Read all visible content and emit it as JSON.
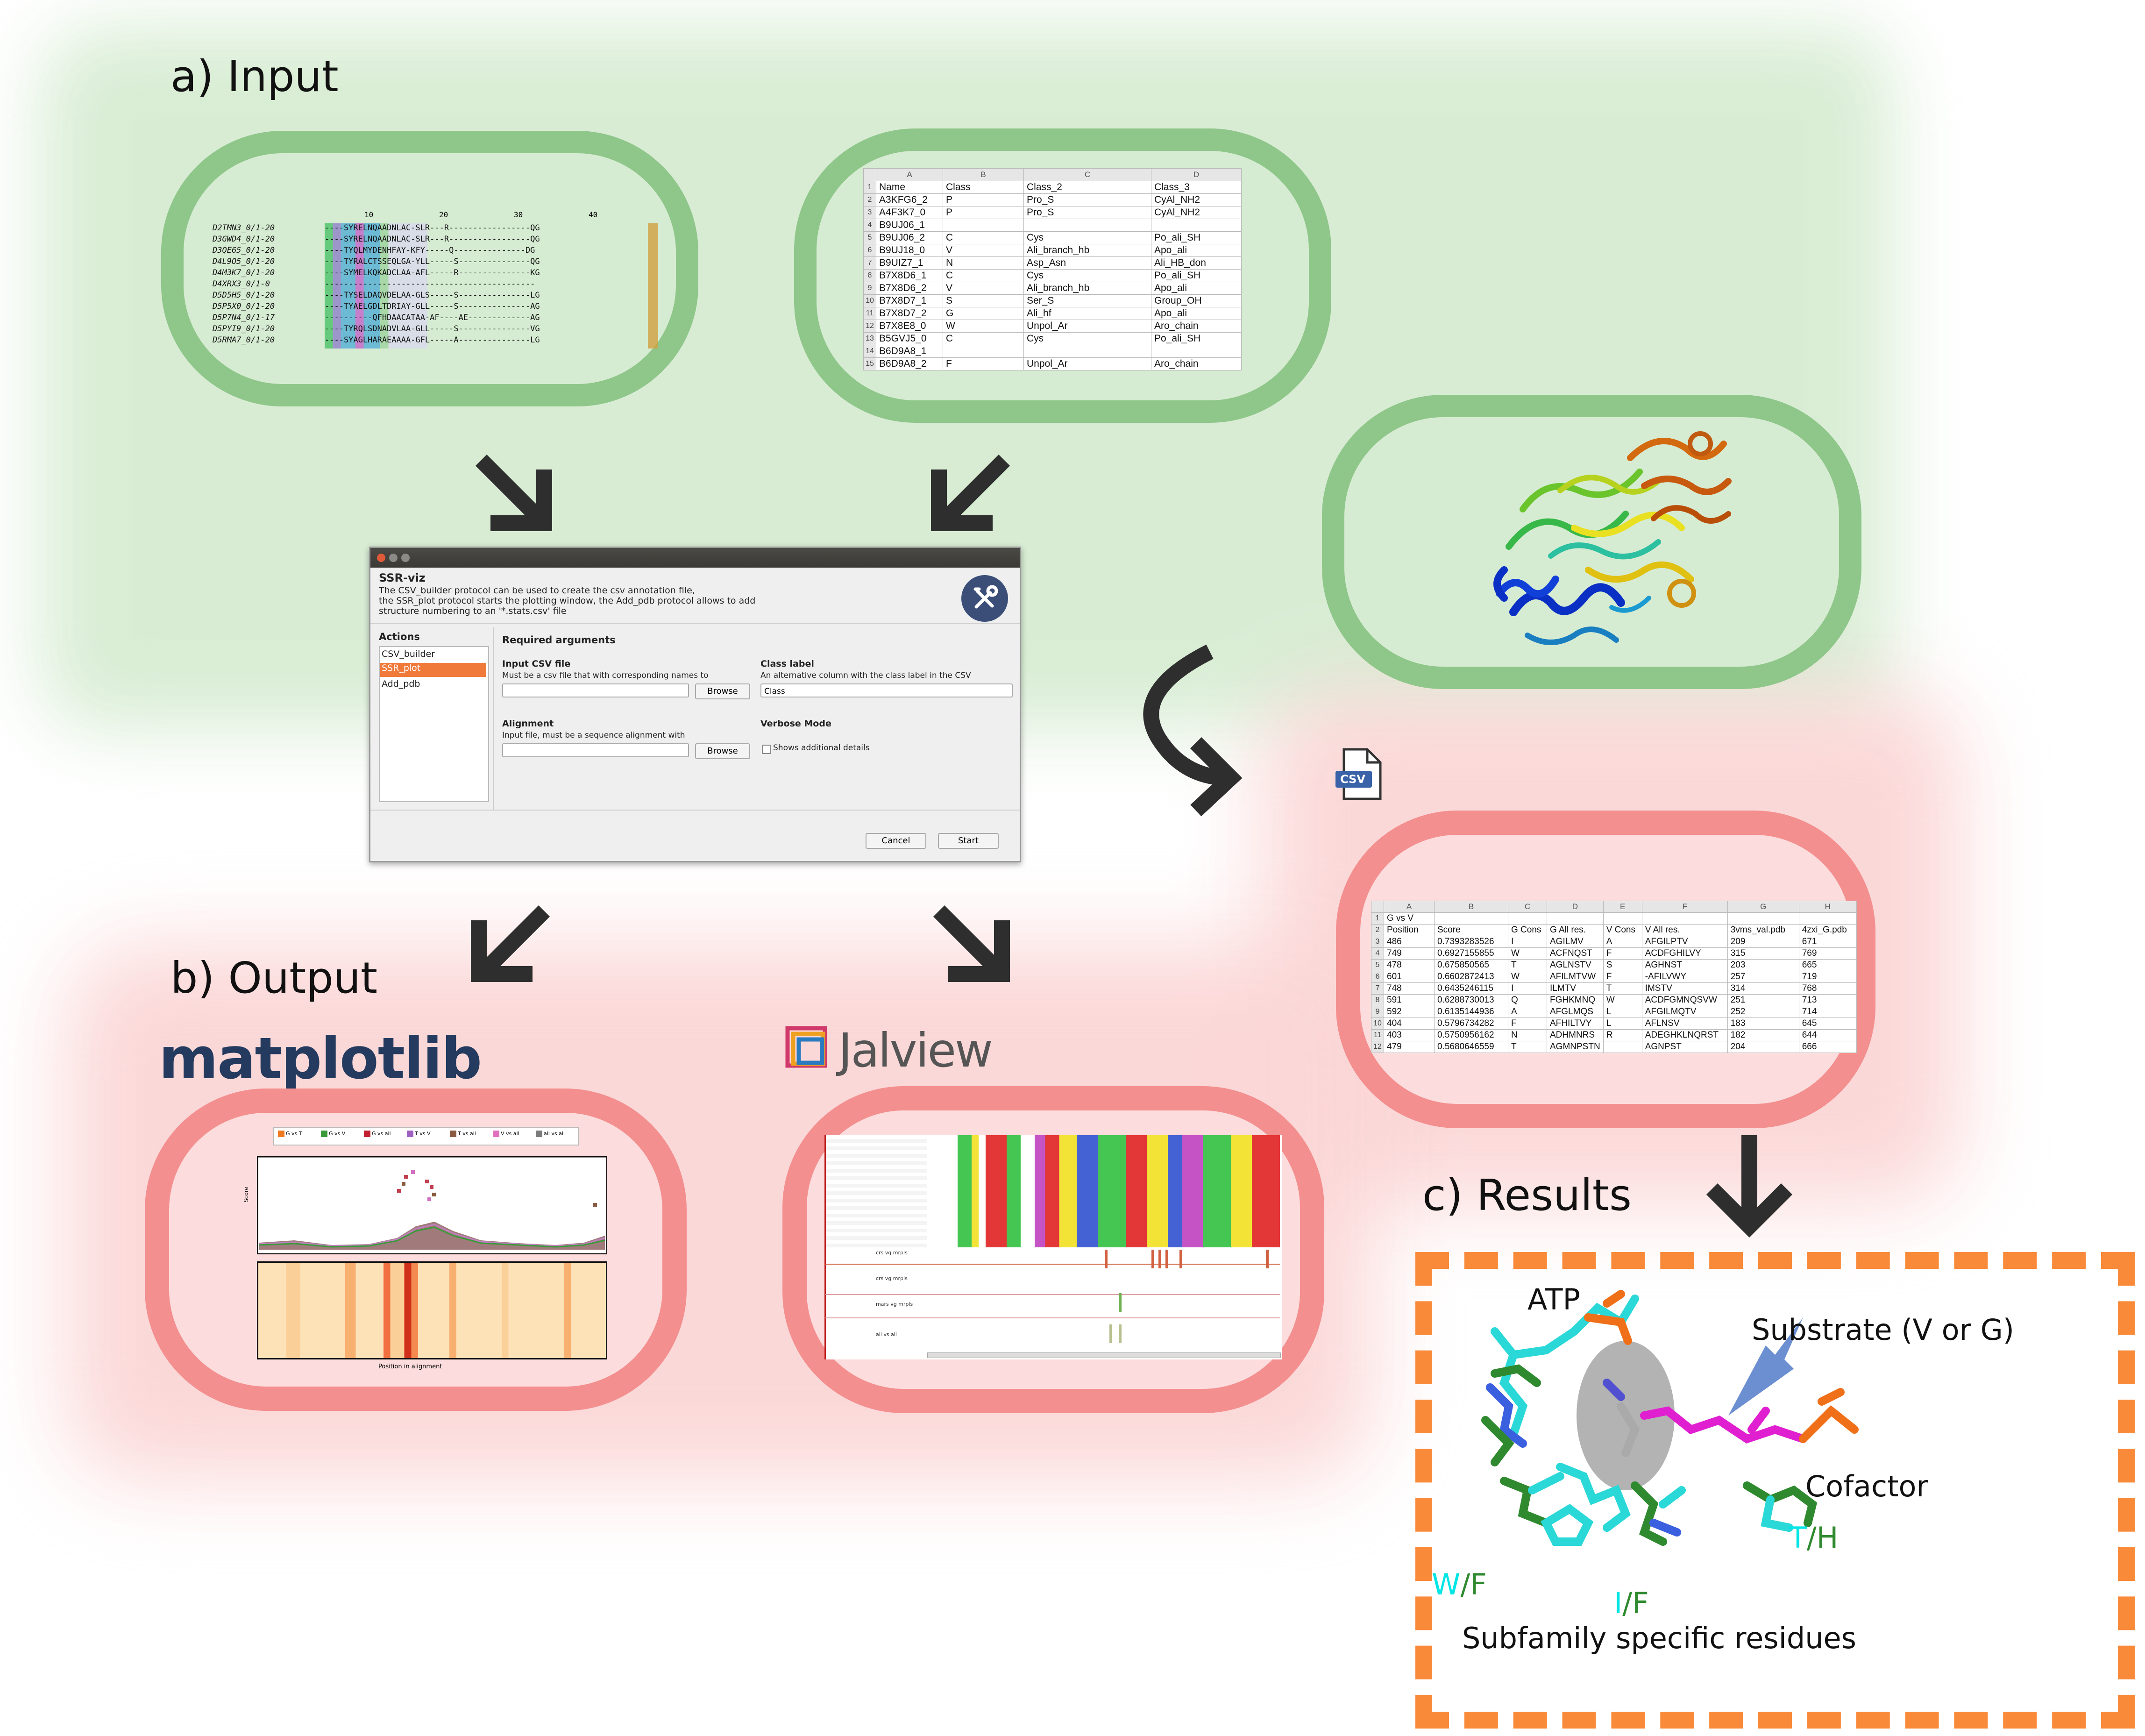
{
  "sections": {
    "input": "a) Input",
    "output": "b) Output",
    "results": "c) Results"
  },
  "alignment": {
    "ruler": [
      "10",
      "20",
      "30",
      "40"
    ],
    "rows": [
      {
        "name": "D2TMN3_0/1-20",
        "seq": "----SYRELNQAADNLAC-SLR---R-----------------QG"
      },
      {
        "name": "D3GWD4_0/1-20",
        "seq": "----SYRELNQAADNLAC-SLR---R-----------------QG"
      },
      {
        "name": "D3QE65_0/1-20",
        "seq": "----TYQLMYDENHFAY-KFY-----Q---------------DG"
      },
      {
        "name": "D4L9O5_0/1-20",
        "seq": "----TYRALCTSSEQLGA-YLL-----S---------------QG"
      },
      {
        "name": "D4M3K7_0/1-20",
        "seq": "----SYMELKQKADCLAA-AFL-----R---------------KG"
      },
      {
        "name": "D4XRX3_0/1-0",
        "seq": "--------------------------------------------"
      },
      {
        "name": "D5D5H5_0/1-20",
        "seq": "----TYSELDAQVDELAA-GLS-----S---------------LG"
      },
      {
        "name": "D5P5X0_0/1-20",
        "seq": "----TYAELGDLTDRIAY-GLL-----S---------------AG"
      },
      {
        "name": "D5P7N4_0/1-17",
        "seq": "----------QFHDAACATAA-AF----AE-------------AG"
      },
      {
        "name": "D5PYI9_0/1-20",
        "seq": "----TYRQLSDNADVLAA-GLL-----S---------------VG"
      },
      {
        "name": "D5RMA7_0/1-20",
        "seq": "----SYAGLHARAEAAAA-GFL-----A---------------LG"
      }
    ]
  },
  "class_sheet": {
    "cols": [
      "A",
      "B",
      "C",
      "D"
    ],
    "rows": [
      [
        "Name",
        "Class",
        "Class_2",
        "Class_3"
      ],
      [
        "A3KFG6_2",
        "P",
        "Pro_S",
        "CyAl_NH2"
      ],
      [
        "A4F3K7_0",
        "P",
        "Pro_S",
        "CyAl_NH2"
      ],
      [
        "B9UJ06_1",
        "",
        "",
        ""
      ],
      [
        "B9UJ06_2",
        "C",
        "Cys",
        "Po_ali_SH"
      ],
      [
        "B9UJ18_0",
        "V",
        "Ali_branch_hb",
        "Apo_ali"
      ],
      [
        "B9UIZ7_1",
        "N",
        "Asp_Asn",
        "Ali_HB_don"
      ],
      [
        "B7X8D6_1",
        "C",
        "Cys",
        "Po_ali_SH"
      ],
      [
        "B7X8D6_2",
        "V",
        "Ali_branch_hb",
        "Apo_ali"
      ],
      [
        "B7X8D7_1",
        "S",
        "Ser_S",
        "Group_OH"
      ],
      [
        "B7X8D7_2",
        "G",
        "Ali_hf",
        "Apo_ali"
      ],
      [
        "B7X8E8_0",
        "W",
        "Unpol_Ar",
        "Aro_chain"
      ],
      [
        "B5GVJ5_0",
        "C",
        "Cys",
        "Po_ali_SH"
      ],
      [
        "B6D9A8_1",
        "",
        "",
        ""
      ],
      [
        "B6D9A8_2",
        "F",
        "Unpol_Ar",
        "Aro_chain"
      ]
    ]
  },
  "dialog": {
    "title": "SSR-viz",
    "description": [
      "The CSV_builder protocol can be used to create the csv annotation file,",
      "the SSR_plot protocol starts the plotting window, the Add_pdb protocol allows to add",
      "structure numbering to an '*.stats.csv' file"
    ],
    "actions_label": "Actions",
    "actions": [
      "CSV_builder",
      "SSR_plot",
      "Add_pdb"
    ],
    "selected_action": "SSR_plot",
    "required_label": "Required arguments",
    "input_csv_label": "Input CSV file",
    "input_csv_hint": "Must be a csv file that with corresponding names to",
    "class_label_label": "Class label",
    "class_label_hint": "An alternative column with the class label in the CSV",
    "class_label_value": "Class",
    "alignment_label": "Alignment",
    "alignment_hint": "Input file, must be a sequence alignment with",
    "verbose_label": "Verbose Mode",
    "verbose_hint": "Shows additional details",
    "browse": "Browse",
    "cancel": "Cancel",
    "start": "Start"
  },
  "csv_icon_label": "CSV",
  "results_sheet": {
    "cols": [
      "A",
      "B",
      "C",
      "D",
      "E",
      "F",
      "G",
      "H"
    ],
    "rows": [
      [
        "G vs V",
        "",
        "",
        "",
        "",
        "",
        "",
        ""
      ],
      [
        "Position",
        "Score",
        "G Cons",
        "G All res.",
        "V Cons",
        "V All res.",
        "3vms_val.pdb",
        "4zxi_G.pdb"
      ],
      [
        "486",
        "0.7393283526",
        "I",
        "AGILMV",
        "A",
        "AFGILPTV",
        "209",
        "671"
      ],
      [
        "749",
        "0.6927155855",
        "W",
        "ACFNQST",
        "F",
        "ACDFGHILVY",
        "315",
        "769"
      ],
      [
        "478",
        "0.675850565",
        "T",
        "AGLNSTV",
        "S",
        "AGHNST",
        "203",
        "665"
      ],
      [
        "601",
        "0.6602872413",
        "W",
        "AFILMTVW",
        "F",
        "-AFILVWY",
        "257",
        "719"
      ],
      [
        "748",
        "0.6435246115",
        "I",
        "ILMTV",
        "T",
        "IMSTV",
        "314",
        "768"
      ],
      [
        "591",
        "0.6288730013",
        "Q",
        "FGHKMNQ",
        "W",
        "ACDFGMNQSVW",
        "251",
        "713"
      ],
      [
        "592",
        "0.6135144936",
        "A",
        "AFGLMQS",
        "L",
        "AFGILMQTV",
        "252",
        "714"
      ],
      [
        "404",
        "0.5796734282",
        "F",
        "AFHILTVY",
        "L",
        "AFLNSV",
        "183",
        "645"
      ],
      [
        "403",
        "0.5750956162",
        "N",
        "ADHMNRS",
        "R",
        "ADEGHKLNQRST",
        "182",
        "644"
      ],
      [
        "479",
        "0.5680646559",
        "T",
        "AGMNPSTN",
        "",
        "AGNPST",
        "204",
        "666"
      ]
    ]
  },
  "logos": {
    "matplotlib": "matplotlib",
    "jalview": "Jalview"
  },
  "plot": {
    "legend": [
      "G vs T",
      "G vs V",
      "G vs all",
      "T vs V",
      "T vs all",
      "V vs all",
      "all vs all"
    ],
    "xlabel": "Position in alignment",
    "ylabel": "Score",
    "rows": [
      "G vs T",
      "G vs V",
      "T vs V",
      "T vs all",
      "V vs all",
      "all vs all"
    ]
  },
  "jalview": {
    "tracks": [
      "crs vg mrpls",
      "crs vg mrpls",
      "mars vg mrpls",
      "all vs all"
    ]
  },
  "results": {
    "atp": "ATP",
    "substrate": "Substrate (V or G)",
    "cofactor": "Cofactor",
    "th_t": "T",
    "th_h": "/H",
    "wf_w": "W",
    "wf_f": "/F",
    "if_i": "I",
    "if_f": "/F",
    "subfamily": "Subfamily specific residues"
  },
  "colors": {
    "green_border": "#8fc68a",
    "green_bg": "#d6ecd2",
    "red_border": "#f48f8f",
    "red_bg": "#fcdcdc",
    "orange_dash": "#f98a3a",
    "arrow": "#2e2e2e",
    "cyan": "#00e5e5",
    "dark_green": "#2f8a2f"
  }
}
